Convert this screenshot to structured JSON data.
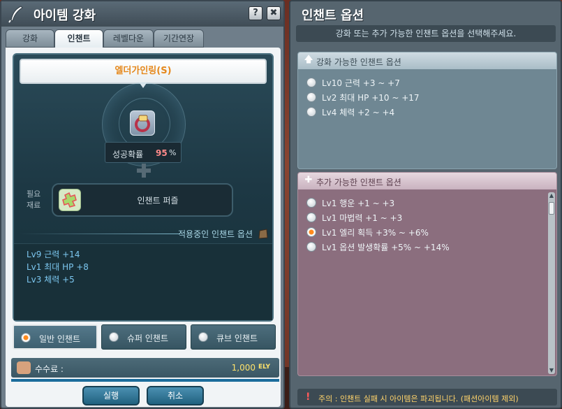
{
  "left_window": {
    "title": "아이템 강화",
    "help_label": "?",
    "close_label": "✖",
    "tabs": [
      {
        "label": "강화"
      },
      {
        "label": "인챈트"
      },
      {
        "label": "레벨다운"
      },
      {
        "label": "기간연장"
      }
    ],
    "active_tab": "인챈트",
    "scroll_name": "엘더가인링(S)",
    "success_label": "성공확률",
    "success_value": "95",
    "success_unit": "%",
    "required_label": "필요 재료",
    "required_item": "인챈트 퍼즐",
    "applied_title": "적용중인 인챈트 옵션",
    "applied_options": [
      "Lv9 근력 +14",
      "Lv1 최대 HP +8",
      "Lv3 체력 +5"
    ],
    "enchant_types": [
      {
        "label": "일반 인챈트",
        "selected": true
      },
      {
        "label": "슈퍼 인챈트",
        "selected": false
      },
      {
        "label": "큐브 인챈트",
        "selected": false
      }
    ],
    "fee_label": "수수료 :",
    "fee_value": "1,000",
    "fee_unit": "ELY",
    "execute_label": "실행",
    "cancel_label": "취소"
  },
  "right_window": {
    "title": "인챈트 옵션",
    "subtitle": "강화 또는 추가 가능한 인챈트 옵션을 선택해주세요.",
    "upgradable_header": "강화 가능한 인챈트 옵션",
    "upgradable_options": [
      {
        "label": "Lv10 근력 +3 ~ +7",
        "selected": false
      },
      {
        "label": "Lv2 최대 HP +10 ~ +17",
        "selected": false
      },
      {
        "label": "Lv4 체력 +2 ~ +4",
        "selected": false
      }
    ],
    "addable_header": "추가 가능한 인챈트 옵션",
    "addable_options": [
      {
        "label": "Lv1 행운 +1 ~ +3",
        "selected": false
      },
      {
        "label": "Lv1 마법력 +1 ~ +3",
        "selected": false
      },
      {
        "label": "Lv1 엘리 획득 +3% ~ +6%",
        "selected": true
      },
      {
        "label": "Lv1 옵션 발생확률 +5% ~ +14%",
        "selected": false
      }
    ],
    "warning_icon": "!",
    "warning_text": "주의 : 인챈트 실패 시 아이템은 파괴됩니다. (패션아이템 제외)"
  },
  "colors": {
    "scroll_name": "#e5881c",
    "success_value": "#ff8a8a",
    "applied_option": "#7cc7f0",
    "fee_value": "#ffe36b",
    "warning_text": "#ffd36a",
    "selected_radio": "#ff8a1c"
  },
  "icons": {
    "window_icon": "quill-icon",
    "item": "ring-item-icon",
    "material": "puzzle-icon",
    "fee": "coin-icon",
    "upgradable_header": "arrow-up-icon",
    "addable_header": "plus-icon"
  }
}
